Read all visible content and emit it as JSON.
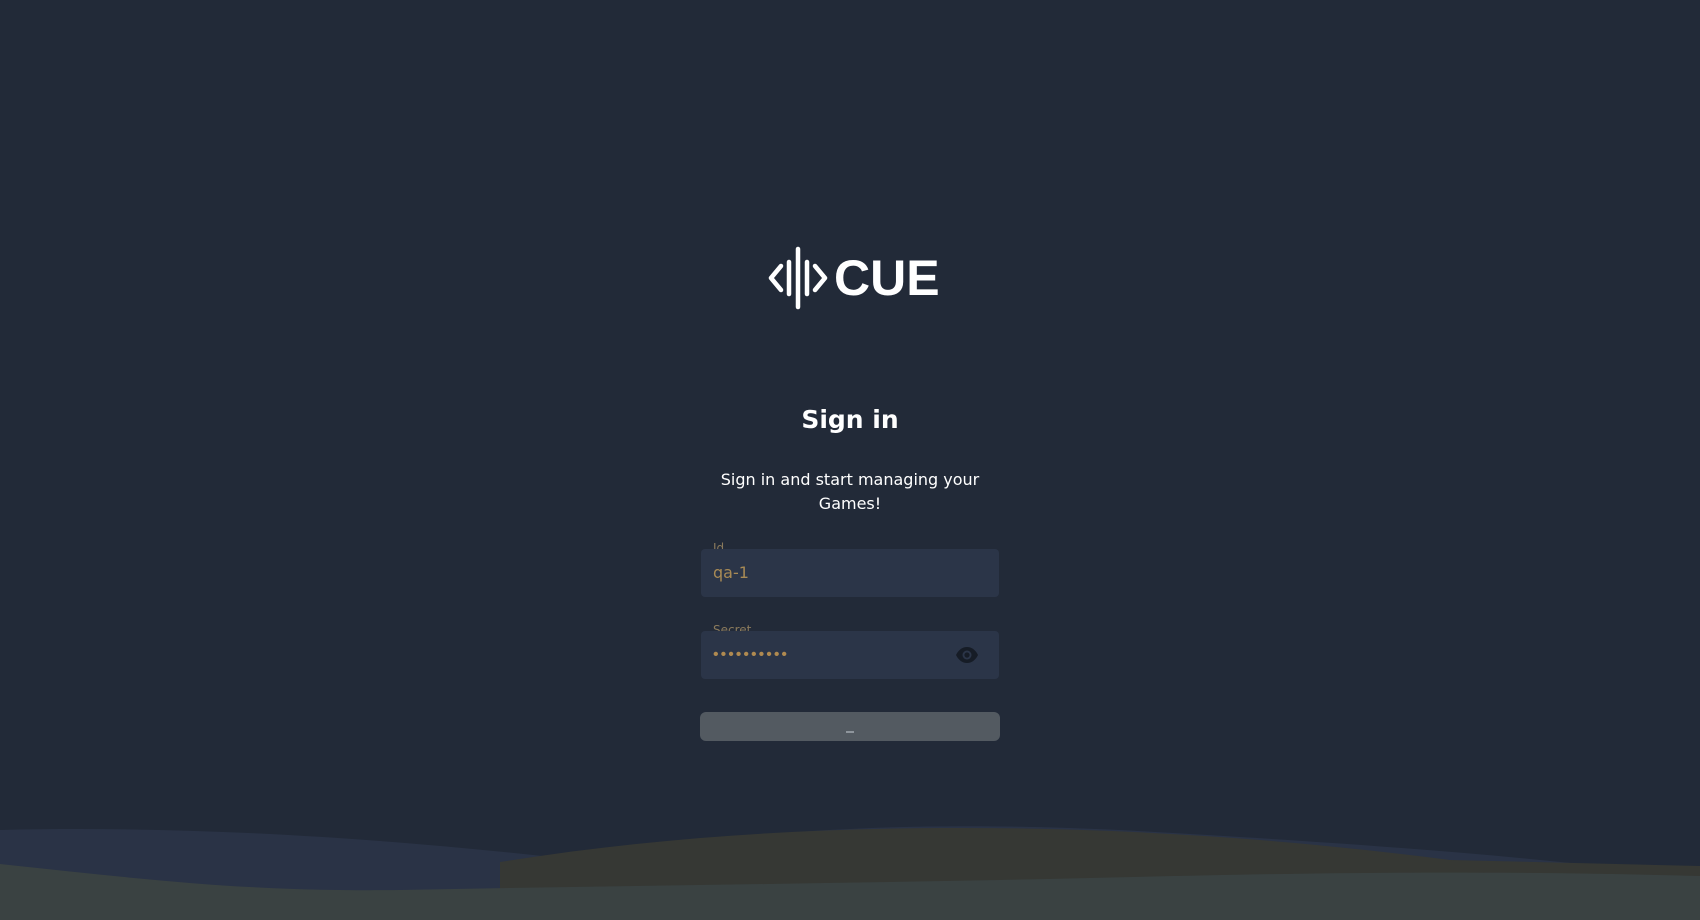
{
  "brand": {
    "logo_text": "CUE"
  },
  "signin": {
    "title": "Sign in",
    "subtitle": "Sign in and start managing your Games!"
  },
  "form": {
    "id_label": "Id",
    "id_value": "qa-1",
    "secret_label": "Secret",
    "secret_value": "••••••••••",
    "submit_state": "loading"
  },
  "colors": {
    "background": "#222a38",
    "field_background": "#2b3548",
    "input_text": "#a88a55",
    "button_disabled": "#535a61",
    "text_primary": "#ffffff"
  },
  "icons": {
    "logo": "cue-waveform-logo",
    "password_toggle": "eye-icon"
  }
}
